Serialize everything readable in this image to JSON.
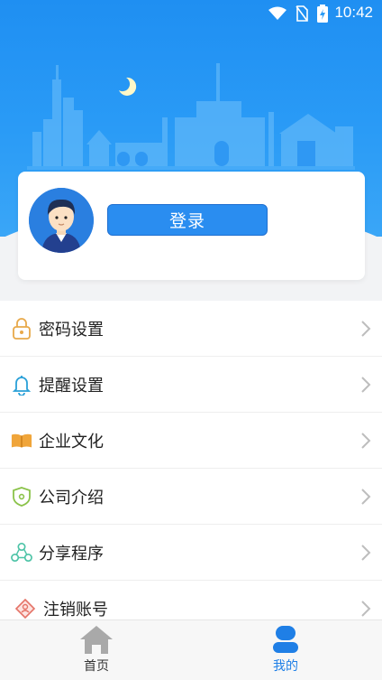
{
  "status_bar": {
    "time": "10:42"
  },
  "profile": {
    "login_label": "登录"
  },
  "menu": {
    "items": [
      {
        "label": "密码设置",
        "icon": "lock-icon"
      },
      {
        "label": "提醒设置",
        "icon": "bell-icon"
      },
      {
        "label": "企业文化",
        "icon": "book-icon"
      },
      {
        "label": "公司介绍",
        "icon": "shield-icon"
      },
      {
        "label": "分享程序",
        "icon": "share-icon"
      },
      {
        "label": "注销账号",
        "icon": "account-cancel-icon"
      }
    ]
  },
  "bottom_nav": {
    "tabs": [
      {
        "label": "首页",
        "icon": "home-icon",
        "active": false
      },
      {
        "label": "我的",
        "icon": "user-icon",
        "active": true
      }
    ]
  },
  "colors": {
    "primary": "#2a8df0",
    "active_tab": "#1f7fe6"
  }
}
